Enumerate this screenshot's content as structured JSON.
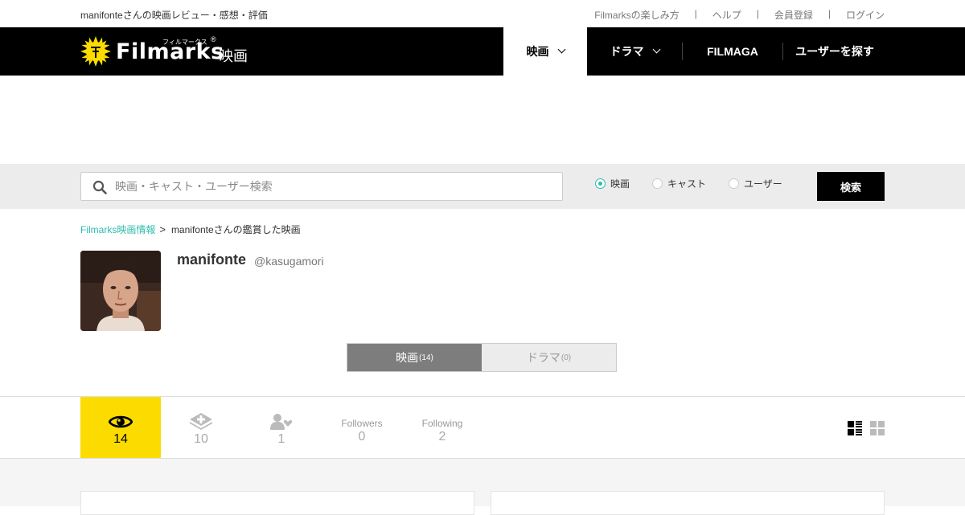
{
  "topbar": {
    "tagline": "manifonteさんの映画レビュー・感想・評価",
    "links": [
      "Filmarksの楽しみ方",
      "ヘルプ",
      "会員登録",
      "ログイン"
    ]
  },
  "header": {
    "brand": "Filmarks",
    "brand_kana": "フィルマークス",
    "registered": "®",
    "section": "映画",
    "nav": {
      "movies": "映画",
      "drama": "ドラマ",
      "filmaga": "FILMAGA",
      "find_users": "ユーザーを探す"
    }
  },
  "search": {
    "placeholder": "映画・キャスト・ユーザー検索",
    "value": "",
    "options": [
      "映画",
      "キャスト",
      "ユーザー"
    ],
    "selected": "映画",
    "button": "検索"
  },
  "breadcrumb": {
    "home": "Filmarks映画情報",
    "separator": ">",
    "current": "manifonteさんの鑑賞した映画"
  },
  "profile": {
    "name": "manifonte",
    "handle": "@kasugamori"
  },
  "tabs": [
    {
      "label": "映画",
      "count": "(14)"
    },
    {
      "label": "ドラマ",
      "count": "(0)"
    }
  ],
  "stats": {
    "watched": {
      "icon": "eye-icon",
      "value": "14"
    },
    "clips": {
      "icon": "clip-icon",
      "value": "10"
    },
    "fans": {
      "icon": "user-heart-icon",
      "value": "1"
    },
    "followers": {
      "label": "Followers",
      "value": "0"
    },
    "following": {
      "label": "Following",
      "value": "2"
    }
  },
  "colors": {
    "accent": "#fcdc00",
    "link": "#2ebcae",
    "header_bg": "#000000"
  }
}
